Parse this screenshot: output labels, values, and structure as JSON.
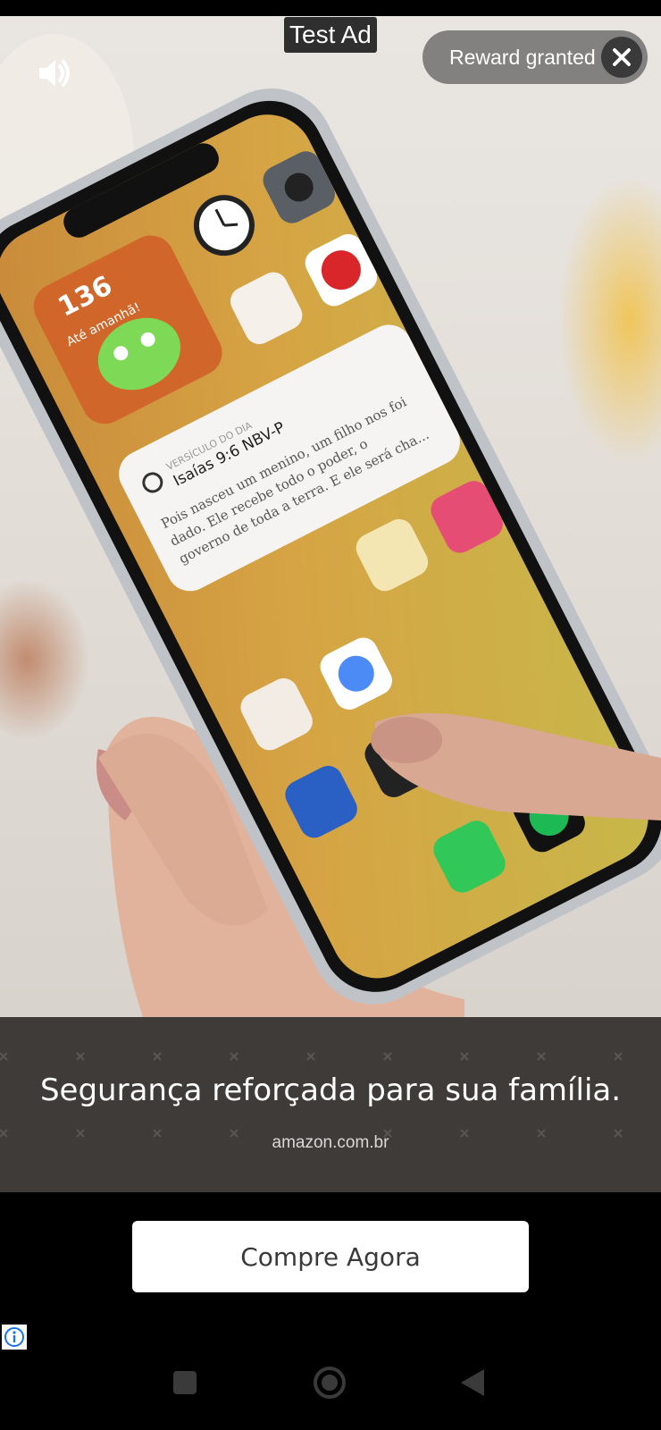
{
  "ad": {
    "test_label": "Test Ad",
    "reward_status": "Reward granted",
    "headline": "Segurança reforçada para sua família.",
    "domain": "amazon.com.br",
    "cta_label": "Compre Agora"
  },
  "phone_content": {
    "streak_count": "136",
    "streak_caption": "Até amanhã!",
    "verse_widget_title": "VERSÍCULO DO DIA",
    "verse_reference": "Isaías 9:6 NBV-P",
    "verse_text_line1": "Pois nasceu um menino, um filho nos foi",
    "verse_text_line2": "dado. Ele recebe todo o poder, o",
    "verse_text_line3": "governo de toda a terra. E ele será cha..."
  },
  "icons": {
    "volume": "speaker-volume-icon",
    "close": "close-icon",
    "adchoices": "info-icon",
    "nav_recents": "square-icon",
    "nav_home": "circle-icon",
    "nav_back": "triangle-back-icon"
  },
  "colors": {
    "phone_wallpaper": "#d7a440",
    "caption_band": "#3e3b39",
    "cta_background": "#ffffff",
    "adchoices_blue": "#1a73e8"
  }
}
